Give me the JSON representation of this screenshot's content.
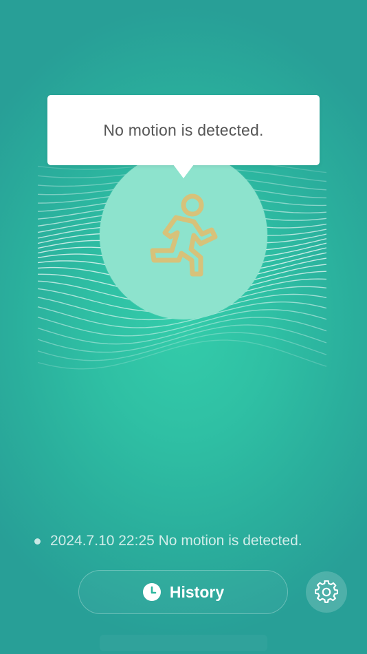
{
  "tooltip": {
    "message": "No motion is detected."
  },
  "sensor": {
    "icon": "running-person-icon",
    "icon_color": "#d7c27a",
    "circle_color": "#8de3cd"
  },
  "status": {
    "text": "2024.7.10 22:25 No motion is detected."
  },
  "actions": {
    "history_label": "History",
    "history_icon": "clock-icon",
    "settings_icon": "gear-icon"
  },
  "colors": {
    "background": "#2fc0a4",
    "text_on_bg": "#ffffff",
    "tooltip_text": "#555555"
  }
}
